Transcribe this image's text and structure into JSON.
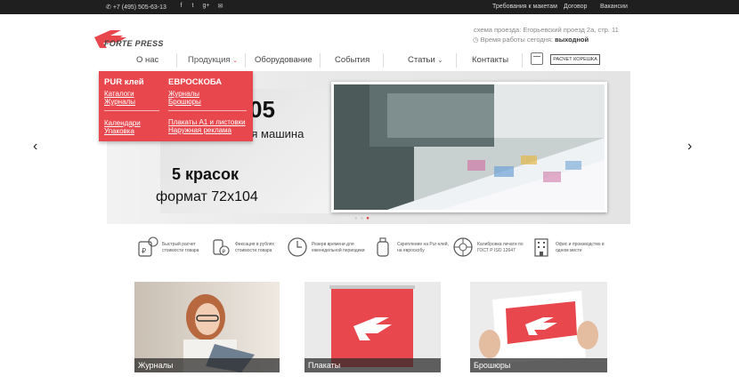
{
  "topbar": {
    "phone": "+7 (495) 505-63-13",
    "social_icons": [
      "facebook-icon",
      "twitter-icon",
      "google-plus-icon",
      "mail-icon"
    ],
    "links": [
      "Требования к макетам",
      "Договор",
      "Вакансии"
    ]
  },
  "header": {
    "logo_text": "FORTE PRESS",
    "address": "схема проезда: Егорьевский проезд 2а, стр. 11",
    "hours_label": "Время работы сегодня:",
    "hours_value": "выходной"
  },
  "nav": {
    "items": [
      "О нас",
      "Продукция",
      "Оборудование",
      "События",
      "Статьи",
      "Контакты"
    ],
    "calc_label": "РАСЧЕТ КОРЕШКА"
  },
  "dropdown": {
    "col1_heading": "PUR клей",
    "col1_links": [
      "Каталоги",
      "Журналы"
    ],
    "col1_links2": [
      "Календари",
      "Упаковка"
    ],
    "col2_heading": "ЕВРОСКОБА",
    "col2_links": [
      "Журналы",
      "Брошюры"
    ],
    "col2_links2": [
      "Плакаты А1 и листовки",
      "Наружная реклама"
    ]
  },
  "slider": {
    "number_text": "05",
    "machine_text": "ная машина",
    "colors_text": "5 красок",
    "format_text": "формат 72х104",
    "prev": "‹",
    "next": "›"
  },
  "features": [
    {
      "icon": "price-calculator-icon",
      "text": "Быстрый расчет стоимости товара"
    },
    {
      "icon": "ruble-fixed-icon",
      "text": "Фиксация в рублях стоимости товара"
    },
    {
      "icon": "time-reserve-icon",
      "text": "Резерв времени для еженедельной периодики"
    },
    {
      "icon": "glue-binding-icon",
      "text": "Скрепление на Pur-клей, на евроскобу"
    },
    {
      "icon": "calibration-icon",
      "text": "Калибровка печати по ГОСТ Р ISO 12647"
    },
    {
      "icon": "office-building-icon",
      "text": "Офис и производство в одном месте"
    }
  ],
  "products": [
    "Журналы",
    "Плакаты",
    "Брошюры"
  ],
  "colors": {
    "brand_red": "#e8484d",
    "topbar": "#1f1f1f"
  }
}
